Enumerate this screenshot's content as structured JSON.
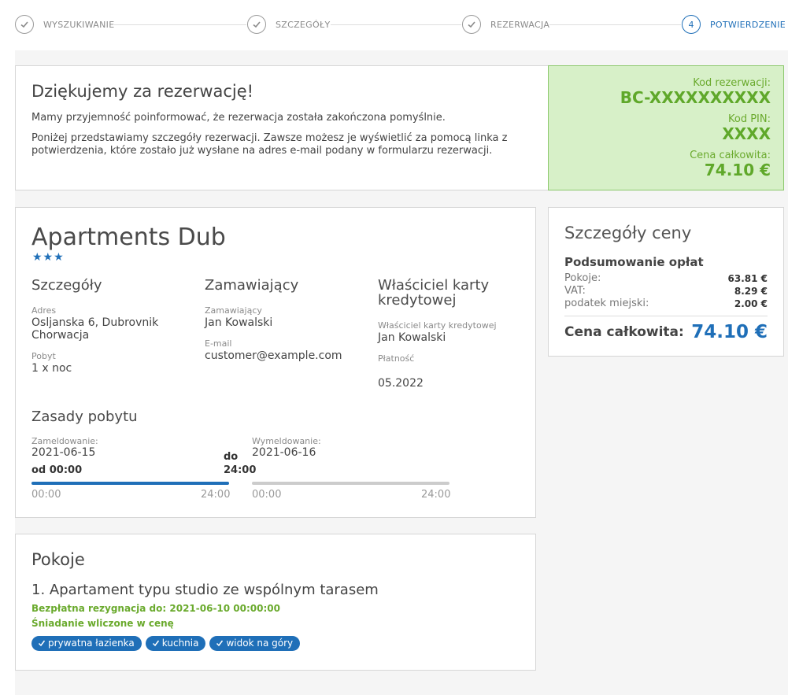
{
  "stepper": {
    "steps": [
      {
        "label": "WYSZUKIWANIE",
        "state": "done"
      },
      {
        "label": "SZCZEGÓŁY",
        "state": "done"
      },
      {
        "label": "REZERWACJA",
        "state": "done"
      },
      {
        "label": "POTWIERDZENIE",
        "state": "active",
        "number": "4"
      }
    ]
  },
  "thanks": {
    "title": "Dziękujemy za rezerwację!",
    "p1": "Mamy przyjemność poinformować, że rezerwacja została zakończona pomyślnie.",
    "p2": "Poniżej przedstawiamy szczegóły rezerwacji. Zawsze możesz je wyświetlić za pomocą linka z potwierdzenia, które zostało już wysłane na adres e-mail podany w formularzu rezerwacji."
  },
  "code_box": {
    "code_label": "Kod rezerwacji:",
    "code_value": "BC-XXXXXXXXXX",
    "pin_label": "Kod PIN:",
    "pin_value": "XXXX",
    "total_label": "Cena całkowita:",
    "total_value": "74.10 €"
  },
  "hotel": {
    "name": "Apartments Dub",
    "stars": "★★★",
    "details": {
      "title": "Szczegóły",
      "address_label": "Adres",
      "address_line1": "Osljanska 6, Dubrovnik",
      "address_line2": "Chorwacja",
      "stay_label": "Pobyt",
      "stay_value": "1 x noc"
    },
    "booker": {
      "title": "Zamawiający",
      "name_label": "Zamawiający",
      "name_value": "Jan Kowalski",
      "email_label": "E-mail",
      "email_value": "customer@example.com"
    },
    "card": {
      "title_line1": "Właściciel karty",
      "title_line2": "kredytowej",
      "holder_label": "Właściciel karty kredytowej",
      "holder_value": "Jan Kowalski",
      "payment_label": "Płatność",
      "payment_value": "05.2022"
    },
    "rules": {
      "title": "Zasady pobytu",
      "checkin_label": "Zameldowanie:",
      "checkin_date": "2021-06-15",
      "checkin_from": "od 00:00",
      "checkin_to_1": "do",
      "checkin_to_2": "24:00",
      "checkin_start": "00:00",
      "checkin_end": "24:00",
      "checkout_label": "Wymeldowanie:",
      "checkout_date": "2021-06-16",
      "checkout_start": "00:00",
      "checkout_end": "24:00"
    }
  },
  "price": {
    "title": "Szczegóły ceny",
    "summary_title": "Podsumowanie opłat",
    "rows": [
      {
        "label": "Pokoje:",
        "value": "63.81 €"
      },
      {
        "label": "VAT:",
        "value": "8.29 €"
      },
      {
        "label": "podatek miejski:",
        "value": "2.00 €"
      }
    ],
    "total_label": "Cena całkowita:",
    "total_value": "74.10 €"
  },
  "rooms": {
    "title": "Pokoje",
    "room_name": "1. Apartament typu studio ze wspólnym tarasem",
    "cancellation": "Bezpłatna rezygnacja do: 2021-06-10 00:00:00",
    "breakfast": "Śniadanie wliczone w cenę",
    "tags": [
      "prywatna łazienka",
      "kuchnia",
      "widok na góry"
    ]
  },
  "colors": {
    "accent": "#1f6fb8",
    "success": "#6aaa2d",
    "success_bg": "#d7f0c8"
  }
}
